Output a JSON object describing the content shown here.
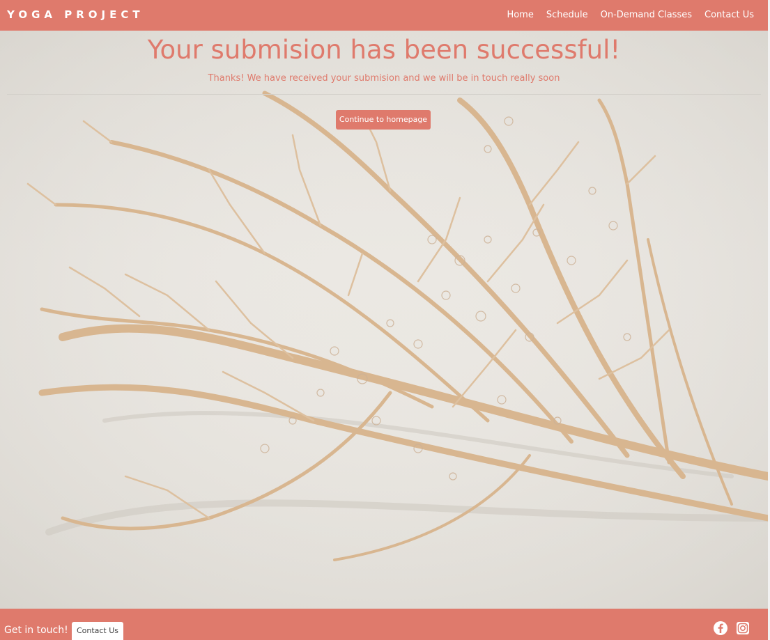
{
  "brand": "YOGA PROJECT",
  "nav": {
    "items": [
      {
        "label": "Home"
      },
      {
        "label": "Schedule"
      },
      {
        "label": "On-Demand Classes"
      },
      {
        "label": "Contact Us"
      }
    ]
  },
  "hero": {
    "title": "Your submision has been successful!",
    "subtitle": "Thanks! We have received your submision and we will be in touch really soon",
    "cta_label": "Continue to homepage"
  },
  "footer": {
    "text": "Get in touch!",
    "button_label": "Contact Us",
    "social_icons": [
      "facebook-icon",
      "instagram-icon"
    ]
  },
  "colors": {
    "accent": "#df7a6c",
    "background": "#e9e6e0",
    "branch": "#d9b48e"
  }
}
